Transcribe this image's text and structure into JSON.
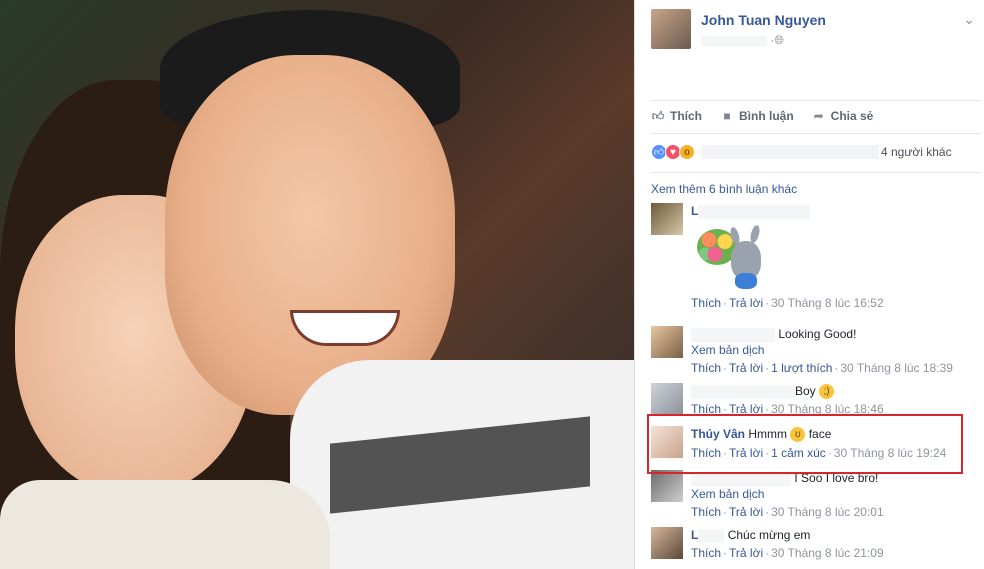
{
  "post": {
    "author": "John Tuan Nguyen",
    "chevron_icon": "chevron-down-icon"
  },
  "actions": {
    "like": "Thích",
    "comment": "Bình luận",
    "share": "Chia sẻ"
  },
  "reactions": {
    "others": "4 người khác"
  },
  "comments_more": "Xem thêm 6 bình luận khác",
  "comments": [
    {
      "name": "L",
      "text": "",
      "like": "Thích",
      "reply": "Trả lời",
      "time": "30 Tháng 8 lúc 16:52"
    },
    {
      "name": "",
      "text": "Looking Good!",
      "translate": "Xem bản dịch",
      "like": "Thích",
      "reply": "Trả lời",
      "likes_count": "1 lượt thích",
      "time": "30 Tháng 8 lúc 18:39"
    },
    {
      "name": "",
      "text": "Boy",
      "like": "Thích",
      "reply": "Trả lời",
      "time": "30 Tháng 8 lúc 18:46"
    },
    {
      "name": "Thúy Vân",
      "text_before": "Hmmm",
      "text_after": "face",
      "like": "Thích",
      "reply": "Trả lời",
      "reactions_count": "1 cảm xúc",
      "time": "30 Tháng 8 lúc 19:24"
    },
    {
      "name": "",
      "text": "I Soo I love bro!",
      "translate": "Xem bản dịch",
      "like": "Thích",
      "reply": "Trả lời",
      "time": "30 Tháng 8 lúc 20:01"
    },
    {
      "name": "L",
      "text": "Chúc mừng em",
      "like": "Thích",
      "reply": "Trả lời",
      "time": "30 Tháng 8 lúc 21:09"
    }
  ],
  "colors": {
    "link": "#365899",
    "meta": "#90949c",
    "highlight": "#d9242b"
  }
}
